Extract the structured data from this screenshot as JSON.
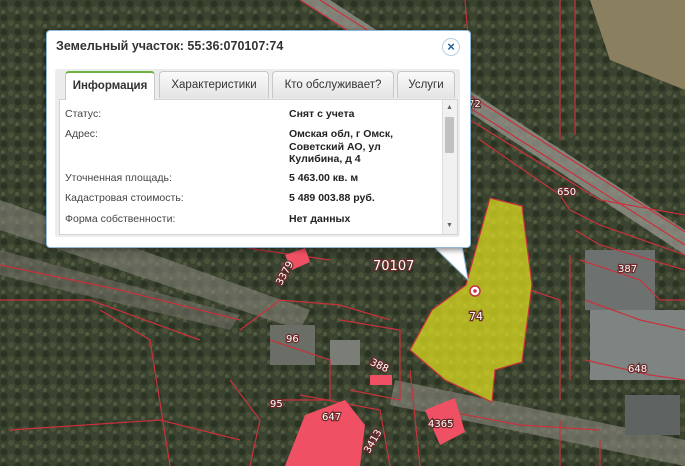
{
  "popup": {
    "title": "Земельный участок: 55:36:070107:74",
    "close_glyph": "×",
    "tabs": [
      {
        "label": "Информация",
        "active": true
      },
      {
        "label": "Характеристики",
        "active": false
      },
      {
        "label": "Кто обслуживает?",
        "active": false
      },
      {
        "label": "Услуги",
        "active": false
      }
    ],
    "rows": [
      {
        "label": "Статус:",
        "value": "Снят с учета"
      },
      {
        "label": "Адрес:",
        "value": "Омская обл, г Омск, Советский АО, ул Кулибина, д 4"
      },
      {
        "label": "Уточненная площадь:",
        "value": "5 463.00 кв. м"
      },
      {
        "label": "Кадастровая стоимость:",
        "value": "5 489 003.88 руб."
      },
      {
        "label": "Форма собственности:",
        "value": "Нет данных"
      }
    ]
  },
  "map": {
    "quarter_label": "70107",
    "selected_parcel_label": "74",
    "parcel_numbers": [
      "650",
      "387",
      "648",
      "3379",
      "96",
      "388",
      "95",
      "647",
      "4365",
      "3413",
      "72"
    ],
    "colors": {
      "boundary": "#c8323c",
      "selected_fill": "#e6e61e",
      "building_fill": "#f05064"
    }
  }
}
